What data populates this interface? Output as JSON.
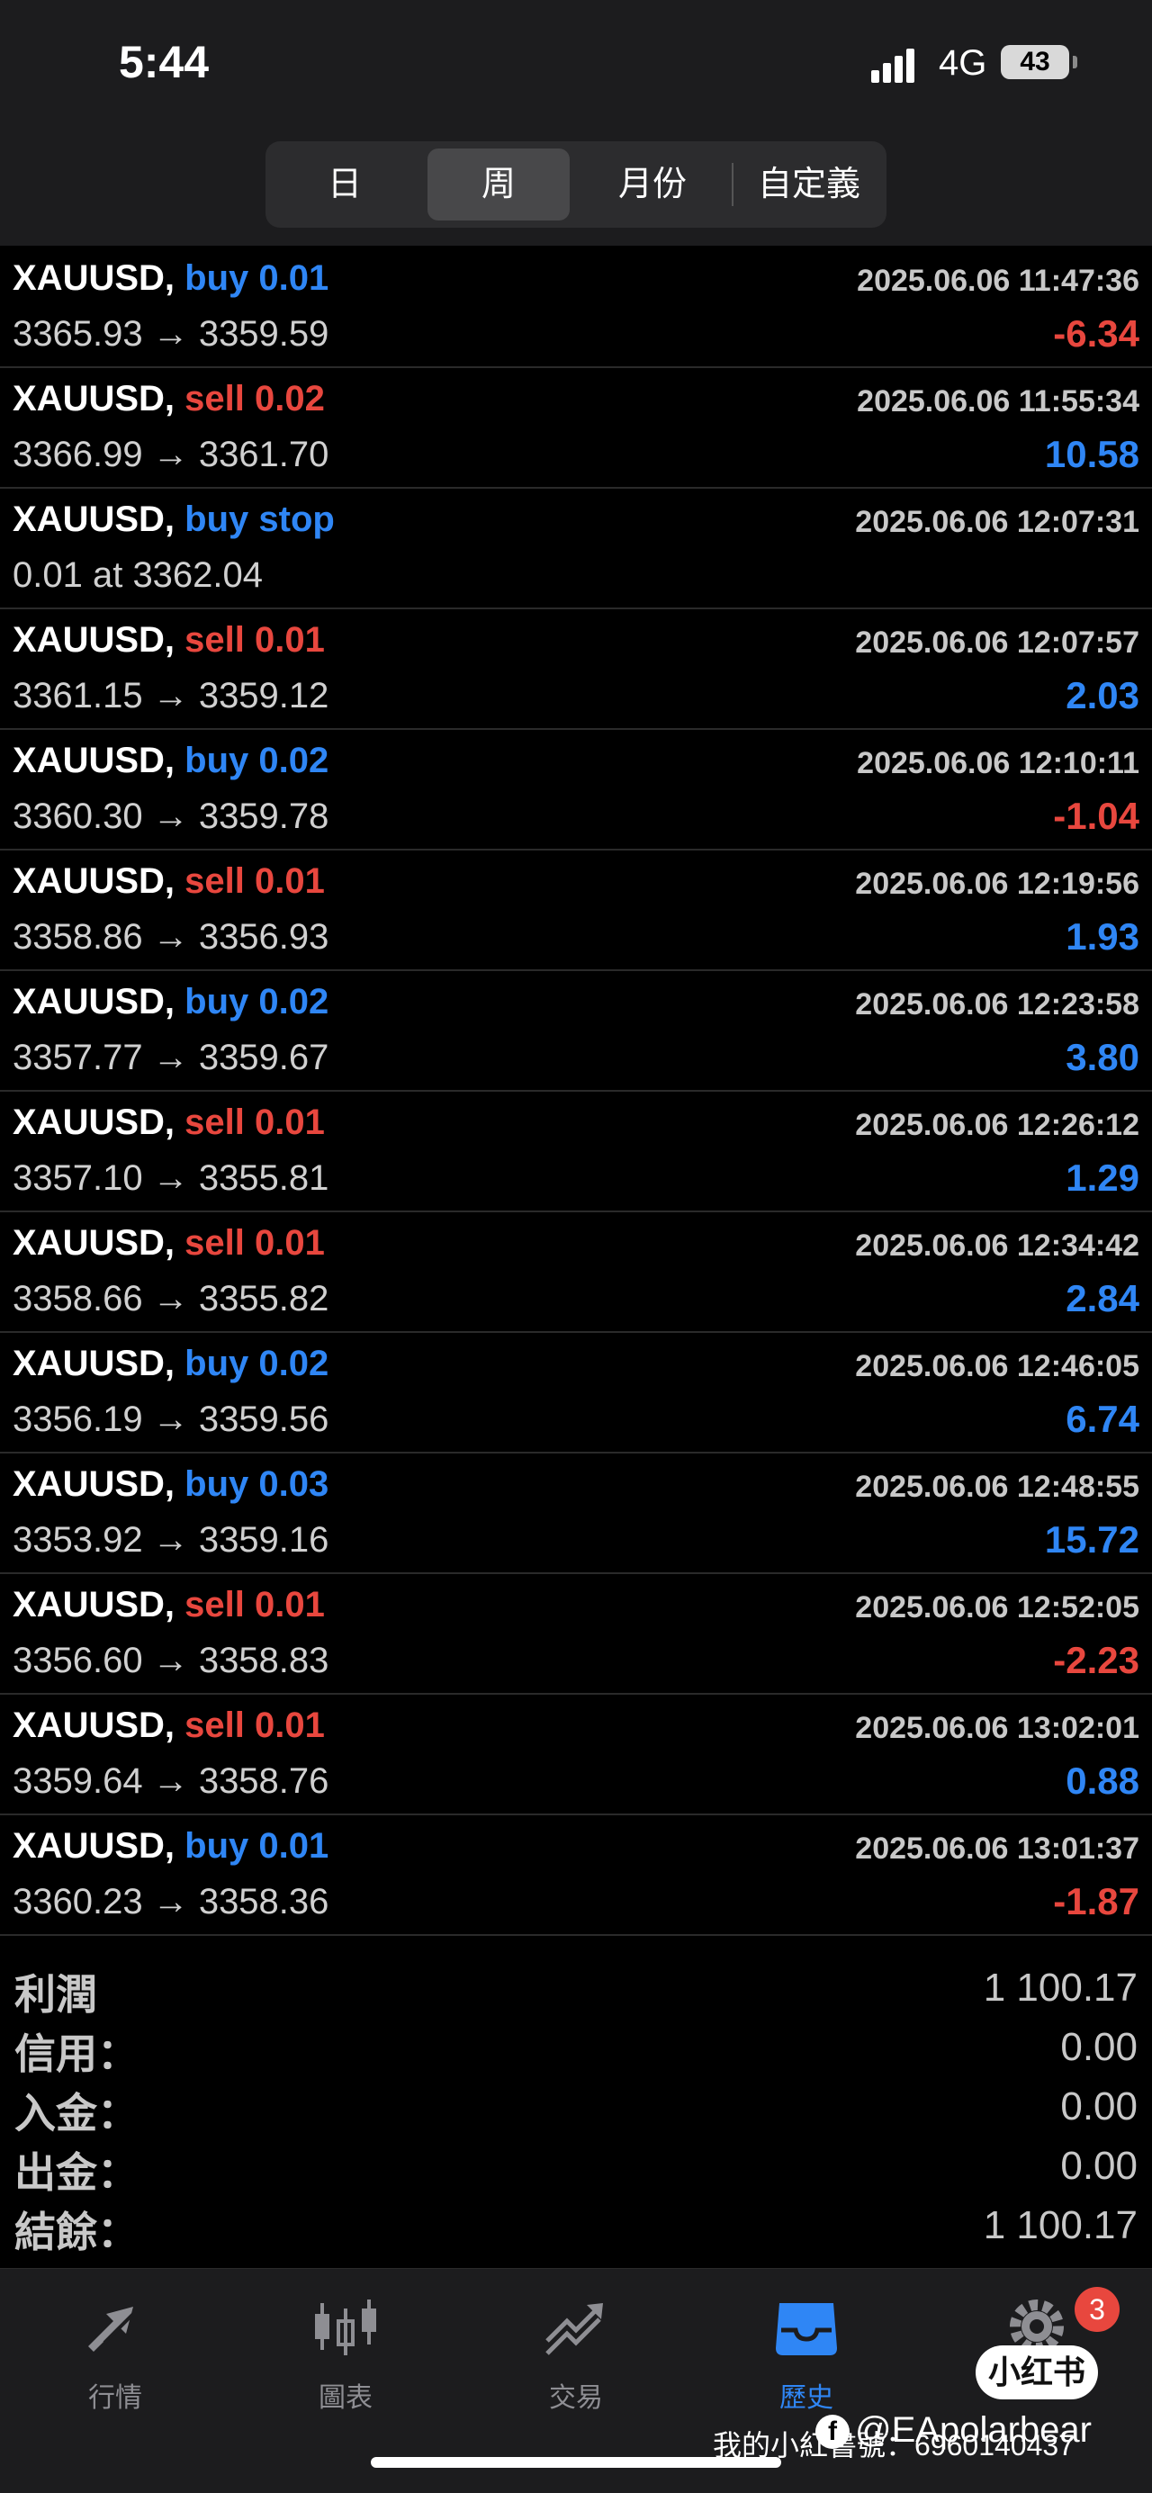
{
  "status_bar": {
    "time": "5:44",
    "network": "4G",
    "battery": "43"
  },
  "tabs": [
    {
      "label": "日",
      "active": false
    },
    {
      "label": "周",
      "active": true
    },
    {
      "label": "月份",
      "active": false
    },
    {
      "label": "自定義",
      "active": false
    }
  ],
  "trades": [
    {
      "symbol": "XAUUSD,",
      "side": "buy 0.01",
      "type": "buy",
      "time": "2025.06.06 11:47:36",
      "prices": "3365.93 → 3359.59",
      "profit": "-6.34",
      "profit_sign": "neg"
    },
    {
      "symbol": "XAUUSD,",
      "side": "sell 0.02",
      "type": "sell",
      "time": "2025.06.06 11:55:34",
      "prices": "3366.99 → 3361.70",
      "profit": "10.58",
      "profit_sign": "pos"
    },
    {
      "symbol": "XAUUSD,",
      "side": "buy stop",
      "type": "buy",
      "time": "2025.06.06 12:07:31",
      "prices": "0.01 at 3362.04",
      "profit": "",
      "profit_sign": "pos"
    },
    {
      "symbol": "XAUUSD,",
      "side": "sell 0.01",
      "type": "sell",
      "time": "2025.06.06 12:07:57",
      "prices": "3361.15 → 3359.12",
      "profit": "2.03",
      "profit_sign": "pos"
    },
    {
      "symbol": "XAUUSD,",
      "side": "buy 0.02",
      "type": "buy",
      "time": "2025.06.06 12:10:11",
      "prices": "3360.30 → 3359.78",
      "profit": "-1.04",
      "profit_sign": "neg"
    },
    {
      "symbol": "XAUUSD,",
      "side": "sell 0.01",
      "type": "sell",
      "time": "2025.06.06 12:19:56",
      "prices": "3358.86 → 3356.93",
      "profit": "1.93",
      "profit_sign": "pos"
    },
    {
      "symbol": "XAUUSD,",
      "side": "buy 0.02",
      "type": "buy",
      "time": "2025.06.06 12:23:58",
      "prices": "3357.77 → 3359.67",
      "profit": "3.80",
      "profit_sign": "pos"
    },
    {
      "symbol": "XAUUSD,",
      "side": "sell 0.01",
      "type": "sell",
      "time": "2025.06.06 12:26:12",
      "prices": "3357.10 → 3355.81",
      "profit": "1.29",
      "profit_sign": "pos"
    },
    {
      "symbol": "XAUUSD,",
      "side": "sell 0.01",
      "type": "sell",
      "time": "2025.06.06 12:34:42",
      "prices": "3358.66 → 3355.82",
      "profit": "2.84",
      "profit_sign": "pos"
    },
    {
      "symbol": "XAUUSD,",
      "side": "buy 0.02",
      "type": "buy",
      "time": "2025.06.06 12:46:05",
      "prices": "3356.19 → 3359.56",
      "profit": "6.74",
      "profit_sign": "pos"
    },
    {
      "symbol": "XAUUSD,",
      "side": "buy 0.03",
      "type": "buy",
      "time": "2025.06.06 12:48:55",
      "prices": "3353.92 → 3359.16",
      "profit": "15.72",
      "profit_sign": "pos"
    },
    {
      "symbol": "XAUUSD,",
      "side": "sell 0.01",
      "type": "sell",
      "time": "2025.06.06 12:52:05",
      "prices": "3356.60 → 3358.83",
      "profit": "-2.23",
      "profit_sign": "neg"
    },
    {
      "symbol": "XAUUSD,",
      "side": "sell 0.01",
      "type": "sell",
      "time": "2025.06.06 13:02:01",
      "prices": "3359.64 → 3358.76",
      "profit": "0.88",
      "profit_sign": "pos"
    },
    {
      "symbol": "XAUUSD,",
      "side": "buy 0.01",
      "type": "buy",
      "time": "2025.06.06 13:01:37",
      "prices": "3360.23 → 3358.36",
      "profit": "-1.87",
      "profit_sign": "neg"
    }
  ],
  "summary": [
    {
      "label": "利潤",
      "value": "1 100.17"
    },
    {
      "label": "信用：",
      "value": "0.00"
    },
    {
      "label": "入金：",
      "value": "0.00"
    },
    {
      "label": "出金：",
      "value": "0.00"
    },
    {
      "label": "結餘：",
      "value": "1 100.17"
    }
  ],
  "nav": [
    {
      "label": "行情",
      "icon": "quotes-arrows-icon",
      "active": false
    },
    {
      "label": "圖表",
      "icon": "candlestick-chart-icon",
      "active": false
    },
    {
      "label": "交易",
      "icon": "trade-trend-icon",
      "active": false
    },
    {
      "label": "歷史",
      "icon": "history-inbox-icon",
      "active": true
    },
    {
      "label": "設置",
      "icon": "settings-gear-icon",
      "active": false,
      "badge": "3"
    }
  ],
  "watermark": {
    "logo_text": "小红书",
    "handle": "@EApolarbear",
    "id_line": "我的小紅書號：6960140437",
    "fb_glyph": "f"
  },
  "colors": {
    "buy": "#2f86f5",
    "sell": "#e8473e",
    "active_tab": "#2f86f5"
  }
}
